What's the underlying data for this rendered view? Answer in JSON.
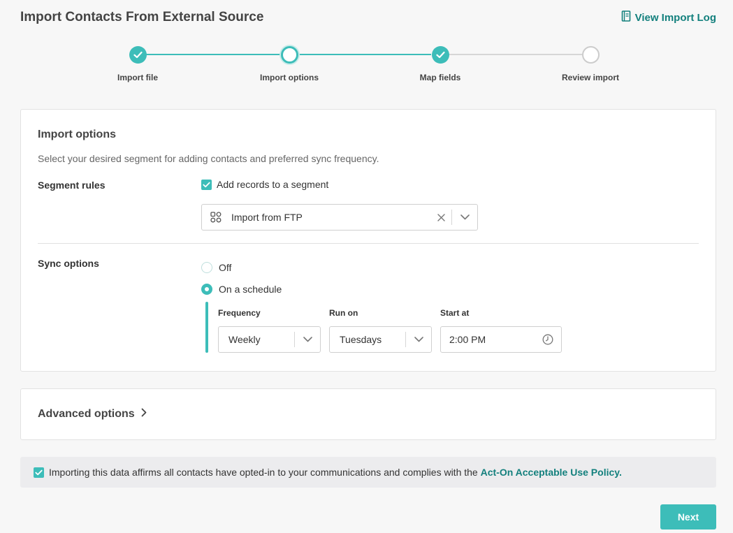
{
  "page": {
    "title": "Import Contacts From External Source",
    "view_log_label": "View Import Log"
  },
  "stepper": {
    "steps": [
      {
        "label": "Import file",
        "state": "done"
      },
      {
        "label": "Import options",
        "state": "current"
      },
      {
        "label": "Map fields",
        "state": "done"
      },
      {
        "label": "Review import",
        "state": "todo"
      }
    ]
  },
  "import_options": {
    "title": "Import options",
    "description": "Select your desired segment for adding contacts and preferred sync frequency.",
    "segment_rules": {
      "label": "Segment rules",
      "checkbox_label": "Add records to a segment",
      "checked": true,
      "segment_value": "Import from FTP"
    },
    "sync_options": {
      "label": "Sync options",
      "off_label": "Off",
      "schedule_label": "On a schedule",
      "selected": "schedule",
      "frequency_label": "Frequency",
      "frequency_value": "Weekly",
      "run_on_label": "Run on",
      "run_on_value": "Tuesdays",
      "start_at_label": "Start at",
      "start_at_value": "2:00 PM"
    }
  },
  "advanced": {
    "title": "Advanced options"
  },
  "consent": {
    "text": "Importing this data affirms all contacts have opted-in to your communications and complies with the",
    "link_text": "Act-On Acceptable Use Policy.",
    "checked": true
  },
  "actions": {
    "next_label": "Next"
  },
  "colors": {
    "accent": "#3dbdb9",
    "link": "#13807d",
    "inactive_step": "#cccccc"
  }
}
